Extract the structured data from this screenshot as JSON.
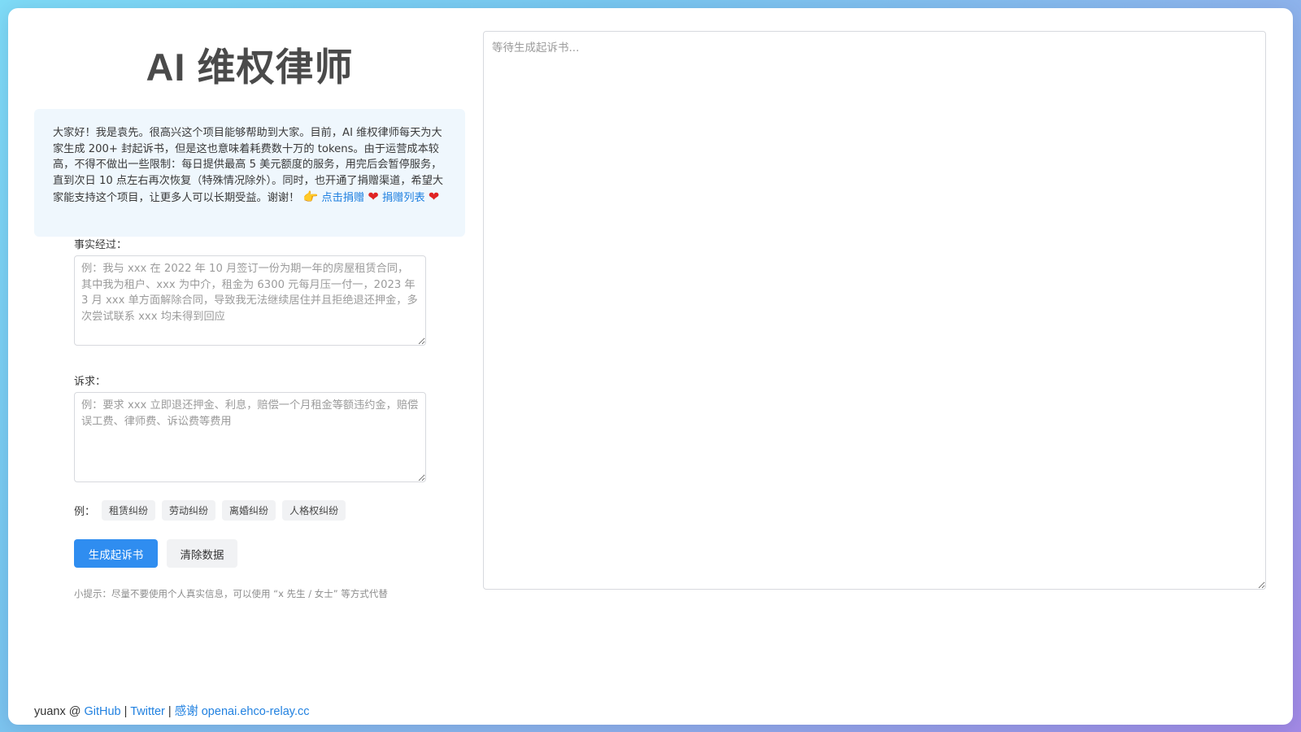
{
  "header": {
    "title": "AI 维权律师"
  },
  "notice": {
    "text": "大家好！我是袁先。很高兴这个项目能够帮助到大家。目前，AI 维权律师每天为大家生成 200+ 封起诉书，但是这也意味着耗费数十万的 tokens。由于运营成本较高，不得不做出一些限制：每日提供最高 5 美元额度的服务，用完后会暂停服务，直到次日 10 点左右再次恢复（特殊情况除外）。同时，也开通了捐赠渠道，希望大家能支持这个项目，让更多人可以长期受益。谢谢！",
    "hand_glyph": "👉",
    "donate_link": "点击捐赠",
    "heart_glyph": "❤",
    "donor_list_link": "捐赠列表"
  },
  "form": {
    "facts_label": "事实经过：",
    "facts_placeholder": "例：我与 xxx 在 2022 年 10 月签订一份为期一年的房屋租赁合同，其中我为租户、xxx 为中介，租金为 6300 元每月压一付一，2023 年 3 月 xxx 单方面解除合同，导致我无法继续居住并且拒绝退还押金，多次尝试联系 xxx 均未得到回应",
    "facts_value": "",
    "claims_label": "诉求：",
    "claims_placeholder": "例：要求 xxx 立即退还押金、利息，赔偿一个月租金等额违约金，赔偿误工费、律师费、诉讼费等费用",
    "claims_value": "",
    "examples_label": "例：",
    "examples": [
      "租赁纠纷",
      "劳动纠纷",
      "离婚纠纷",
      "人格权纠纷"
    ],
    "generate_button": "生成起诉书",
    "clear_button": "清除数据",
    "tip": "小提示：尽量不要使用个人真实信息，可以使用 “x 先生 / 女士” 等方式代替"
  },
  "output": {
    "placeholder": "等待生成起诉书..."
  },
  "footer": {
    "author": "yuanx @ ",
    "github_link": "GitHub",
    "separator": " | ",
    "twitter_link": "Twitter",
    "thanks_link": "感谢 openai.ehco-relay.cc"
  },
  "colors": {
    "accent": "#2f8df0",
    "link": "#2181e0",
    "notice_bg": "#eff7fd",
    "heart": "#e02424"
  },
  "icons": {
    "hand": "pointing-right-hand-icon",
    "heart": "heart-icon"
  }
}
